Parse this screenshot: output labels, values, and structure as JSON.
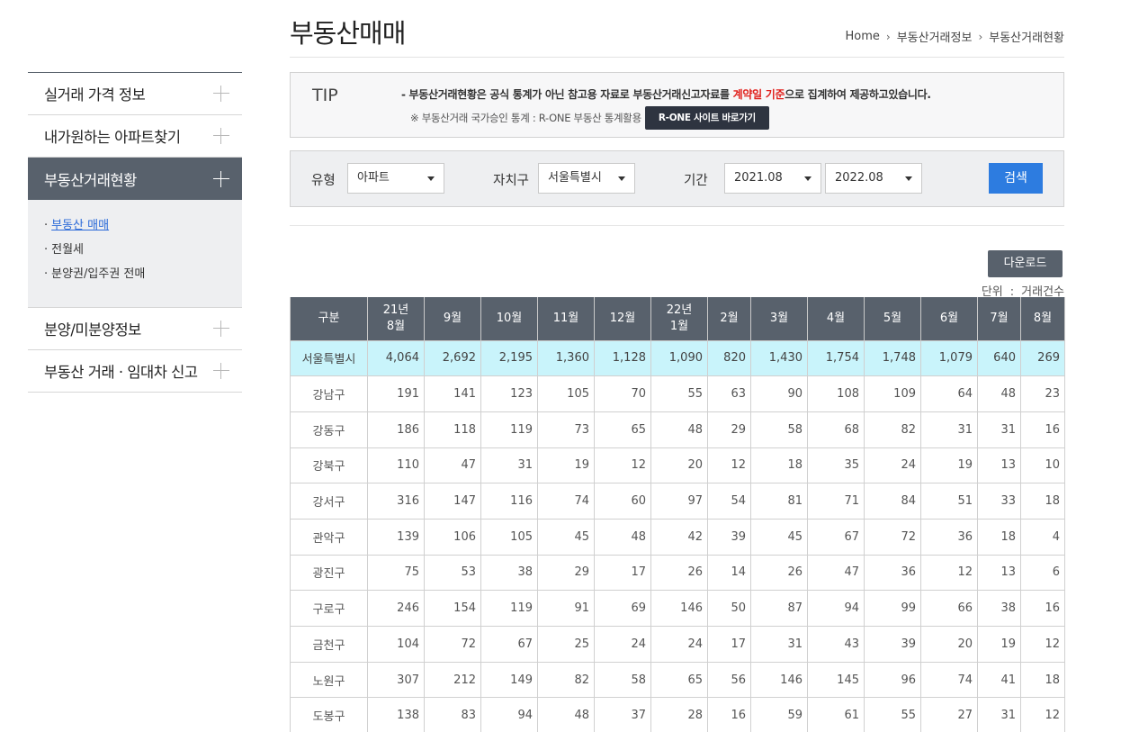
{
  "header": {
    "title": "부동산매매",
    "breadcrumb": [
      "Home",
      "부동산거래정보",
      "부동산거래현황"
    ]
  },
  "sidebar": {
    "items": [
      {
        "label": "실거래 가격 정보"
      },
      {
        "label": "내가원하는 아파트찾기"
      },
      {
        "label": "부동산거래현황"
      },
      {
        "label": "분양/미분양정보"
      },
      {
        "label": "부동산 거래 · 임대차 신고"
      }
    ],
    "submenu": [
      {
        "label": "부동산 매매"
      },
      {
        "label": "전월세"
      },
      {
        "label": "분양권/입주권 전매"
      }
    ]
  },
  "tip": {
    "label": "TIP",
    "line1_a": "- 부동산거래현황은 공식 통계가 아닌 참고용 자료로 부동산거래신고자료를 ",
    "line1_red": "계약일 기준",
    "line1_b": "으로 집계하여 제공하고있습니다.",
    "line2": "※ 부동산거래 국가승인 통계 : R-ONE 부동산 통계활용",
    "button": "R-ONE 사이트 바로가기"
  },
  "filter": {
    "type_label": "유형",
    "type_value": "아파트",
    "region_label": "자치구",
    "region_value": "서울특별시",
    "period_label": "기간",
    "period_from": "2021.08",
    "period_to": "2022.08",
    "search_button": "검색"
  },
  "download_button": "다운로드",
  "unit": {
    "label": "단위",
    "colon": ":",
    "value": "거래건수"
  },
  "table": {
    "headers": [
      "구분",
      "21년\n8월",
      "9월",
      "10월",
      "11월",
      "12월",
      "22년\n1월",
      "2월",
      "3월",
      "4월",
      "5월",
      "6월",
      "7월",
      "8월"
    ],
    "rows": [
      [
        "서울특별시",
        "4,064",
        "2,692",
        "2,195",
        "1,360",
        "1,128",
        "1,090",
        "820",
        "1,430",
        "1,754",
        "1,748",
        "1,079",
        "640",
        "269"
      ],
      [
        "강남구",
        "191",
        "141",
        "123",
        "105",
        "70",
        "55",
        "63",
        "90",
        "108",
        "109",
        "64",
        "48",
        "23"
      ],
      [
        "강동구",
        "186",
        "118",
        "119",
        "73",
        "65",
        "48",
        "29",
        "58",
        "68",
        "82",
        "31",
        "31",
        "16"
      ],
      [
        "강북구",
        "110",
        "47",
        "31",
        "19",
        "12",
        "20",
        "12",
        "18",
        "35",
        "24",
        "19",
        "13",
        "10"
      ],
      [
        "강서구",
        "316",
        "147",
        "116",
        "74",
        "60",
        "97",
        "54",
        "81",
        "71",
        "84",
        "51",
        "33",
        "18"
      ],
      [
        "관악구",
        "139",
        "106",
        "105",
        "45",
        "48",
        "42",
        "39",
        "45",
        "67",
        "72",
        "36",
        "18",
        "4"
      ],
      [
        "광진구",
        "75",
        "53",
        "38",
        "29",
        "17",
        "26",
        "14",
        "26",
        "47",
        "36",
        "12",
        "13",
        "6"
      ],
      [
        "구로구",
        "246",
        "154",
        "119",
        "91",
        "69",
        "146",
        "50",
        "87",
        "94",
        "99",
        "66",
        "38",
        "16"
      ],
      [
        "금천구",
        "104",
        "72",
        "67",
        "25",
        "24",
        "24",
        "17",
        "31",
        "43",
        "39",
        "20",
        "19",
        "12"
      ],
      [
        "노원구",
        "307",
        "212",
        "149",
        "82",
        "58",
        "65",
        "56",
        "146",
        "145",
        "96",
        "74",
        "41",
        "18"
      ],
      [
        "도봉구",
        "138",
        "83",
        "94",
        "48",
        "37",
        "28",
        "16",
        "59",
        "61",
        "55",
        "27",
        "31",
        "12"
      ]
    ]
  }
}
